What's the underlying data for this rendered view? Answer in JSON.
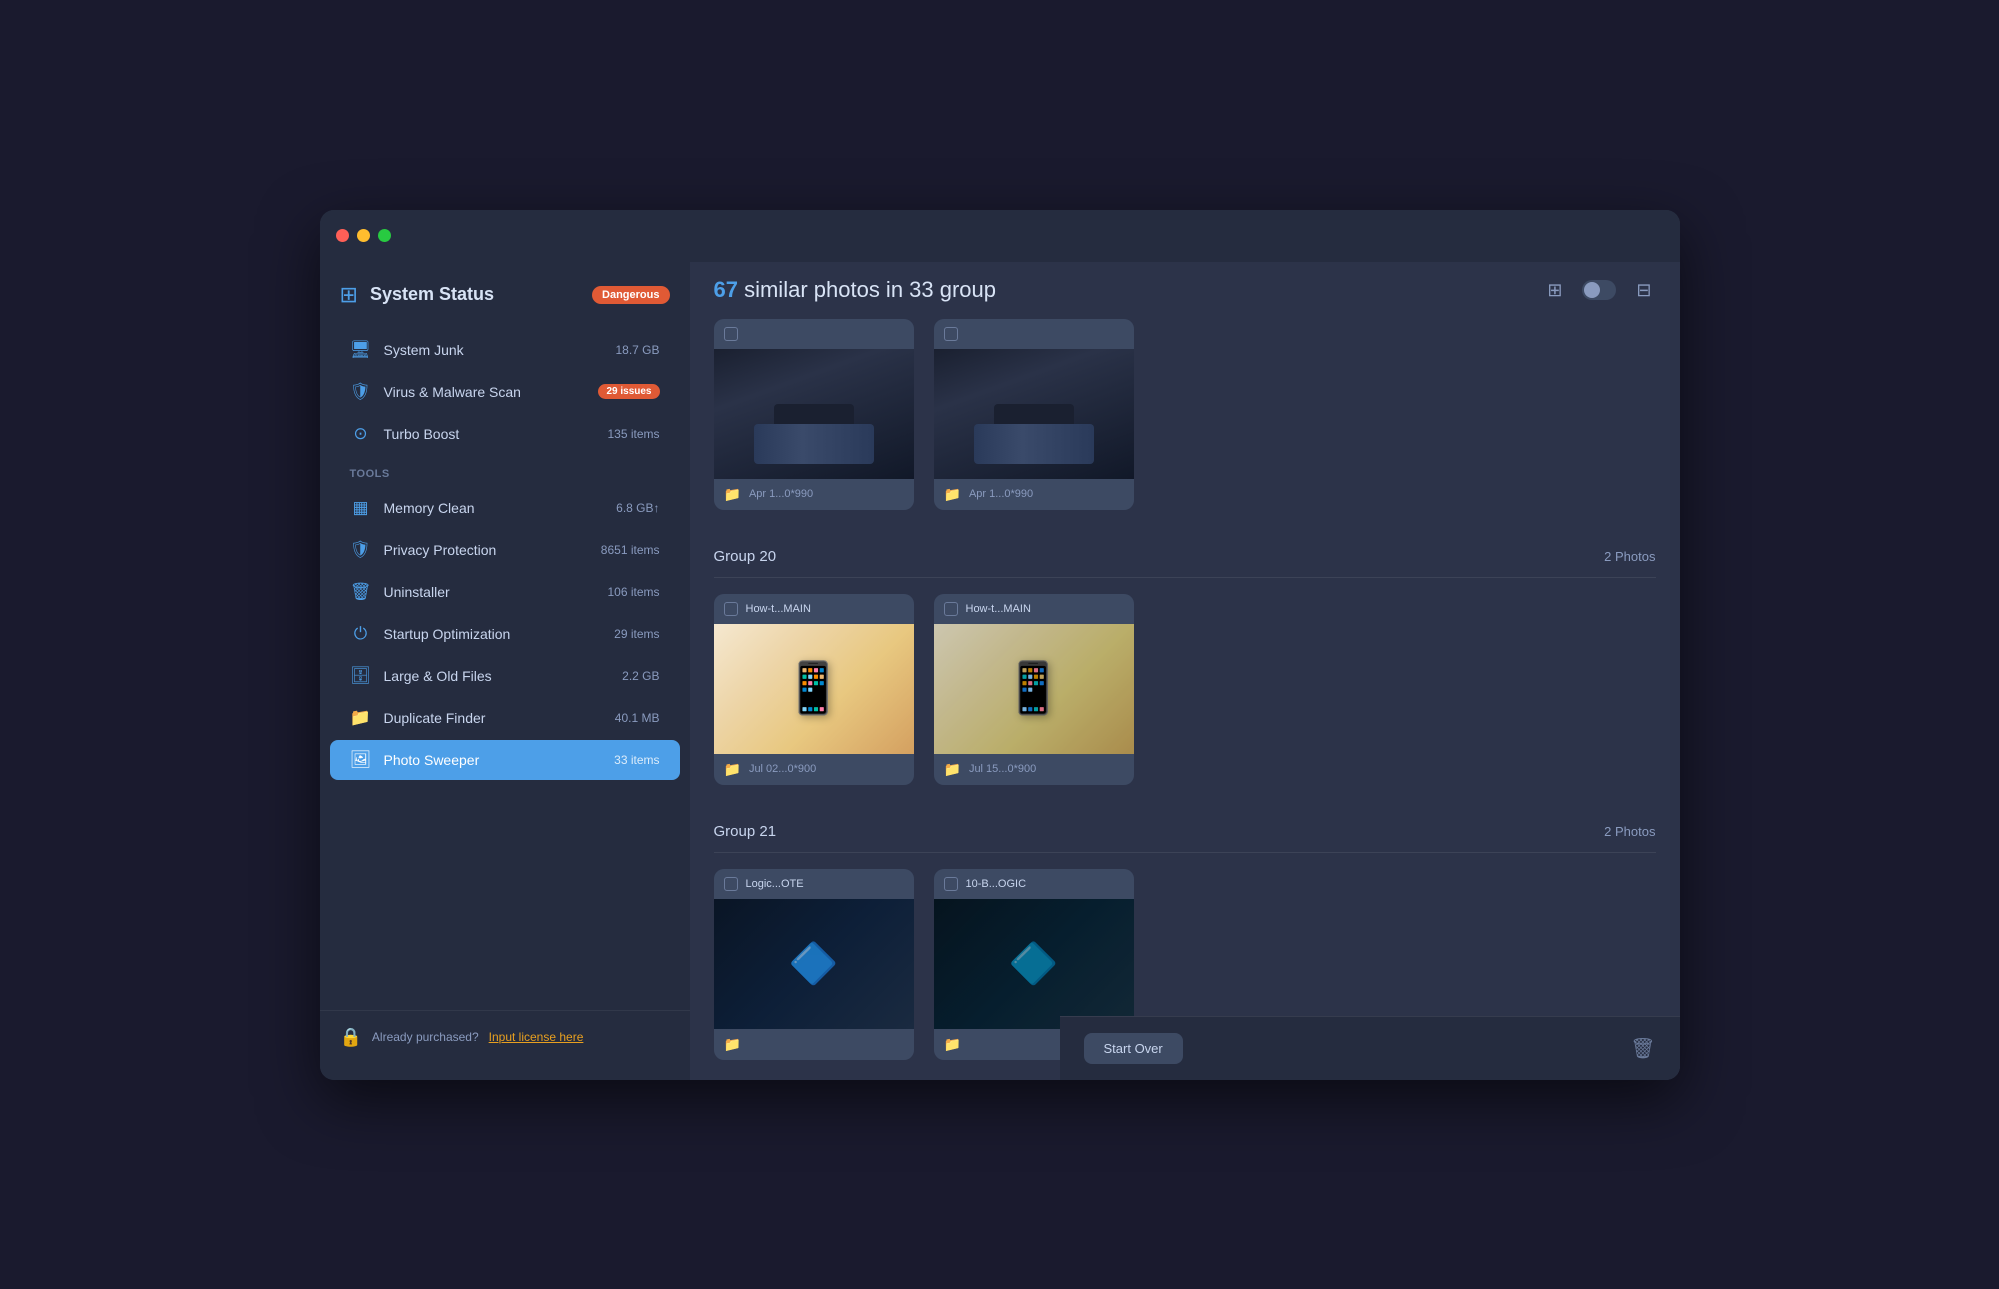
{
  "window": {
    "title": ""
  },
  "traffic_lights": {
    "red": "🔴",
    "yellow": "🟡",
    "green": "🟢"
  },
  "sidebar": {
    "system_status_label": "System Status",
    "badge_dangerous": "Dangerous",
    "items_top": [
      {
        "id": "system-junk",
        "icon": "🖥",
        "label": "System Junk",
        "value": "18.7 GB",
        "badge": null
      },
      {
        "id": "virus-malware",
        "icon": "🛡",
        "label": "Virus & Malware Scan",
        "value": null,
        "badge": "29 issues"
      },
      {
        "id": "turbo-boost",
        "icon": "⊙",
        "label": "Turbo Boost",
        "value": "135 items",
        "badge": null
      }
    ],
    "tools_label": "Tools",
    "items_tools": [
      {
        "id": "memory-clean",
        "icon": "▦",
        "label": "Memory Clean",
        "value": "6.8 GB↑",
        "badge": null
      },
      {
        "id": "privacy-protection",
        "icon": "🛡",
        "label": "Privacy Protection",
        "value": "8651 items",
        "badge": null
      },
      {
        "id": "uninstaller",
        "icon": "🗑",
        "label": "Uninstaller",
        "value": "106 items",
        "badge": null
      },
      {
        "id": "startup-optimization",
        "icon": "⏻",
        "label": "Startup Optimization",
        "value": "29 items",
        "badge": null
      },
      {
        "id": "large-old-files",
        "icon": "🗄",
        "label": "Large & Old Files",
        "value": "2.2 GB",
        "badge": null
      },
      {
        "id": "duplicate-finder",
        "icon": "📁",
        "label": "Duplicate Finder",
        "value": "40.1 MB",
        "badge": null
      },
      {
        "id": "photo-sweeper",
        "icon": "🖼",
        "label": "Photo Sweeper",
        "value": "33 items",
        "badge": null,
        "active": true
      }
    ],
    "footer_text": "Already purchased?",
    "footer_link": "Input license here"
  },
  "main": {
    "title_count": "67",
    "title_rest": " similar photos in 33 group",
    "groups": [
      {
        "id": "group-19-partial",
        "name": "",
        "photos": [
          {
            "name": "Apr 1...0*990",
            "type": "car",
            "meta": "Apr 1...0*990"
          },
          {
            "name": "Apr 1...0*990",
            "type": "car",
            "meta": "Apr 1...0*990"
          }
        ]
      },
      {
        "id": "group-20",
        "name": "Group 20",
        "count": "2 Photos",
        "photos": [
          {
            "name": "How-t...MAIN",
            "type": "phone",
            "meta": "Jul 02...0*900"
          },
          {
            "name": "How-t...MAIN",
            "type": "phone",
            "meta": "Jul 15...0*900"
          }
        ]
      },
      {
        "id": "group-21",
        "name": "Group 21",
        "count": "2 Photos",
        "photos": [
          {
            "name": "Logic...OTE",
            "type": "circuit",
            "meta": ""
          },
          {
            "name": "10-B...OGIC",
            "type": "circuit",
            "meta": ""
          }
        ]
      }
    ],
    "start_over_label": "Start Over"
  }
}
